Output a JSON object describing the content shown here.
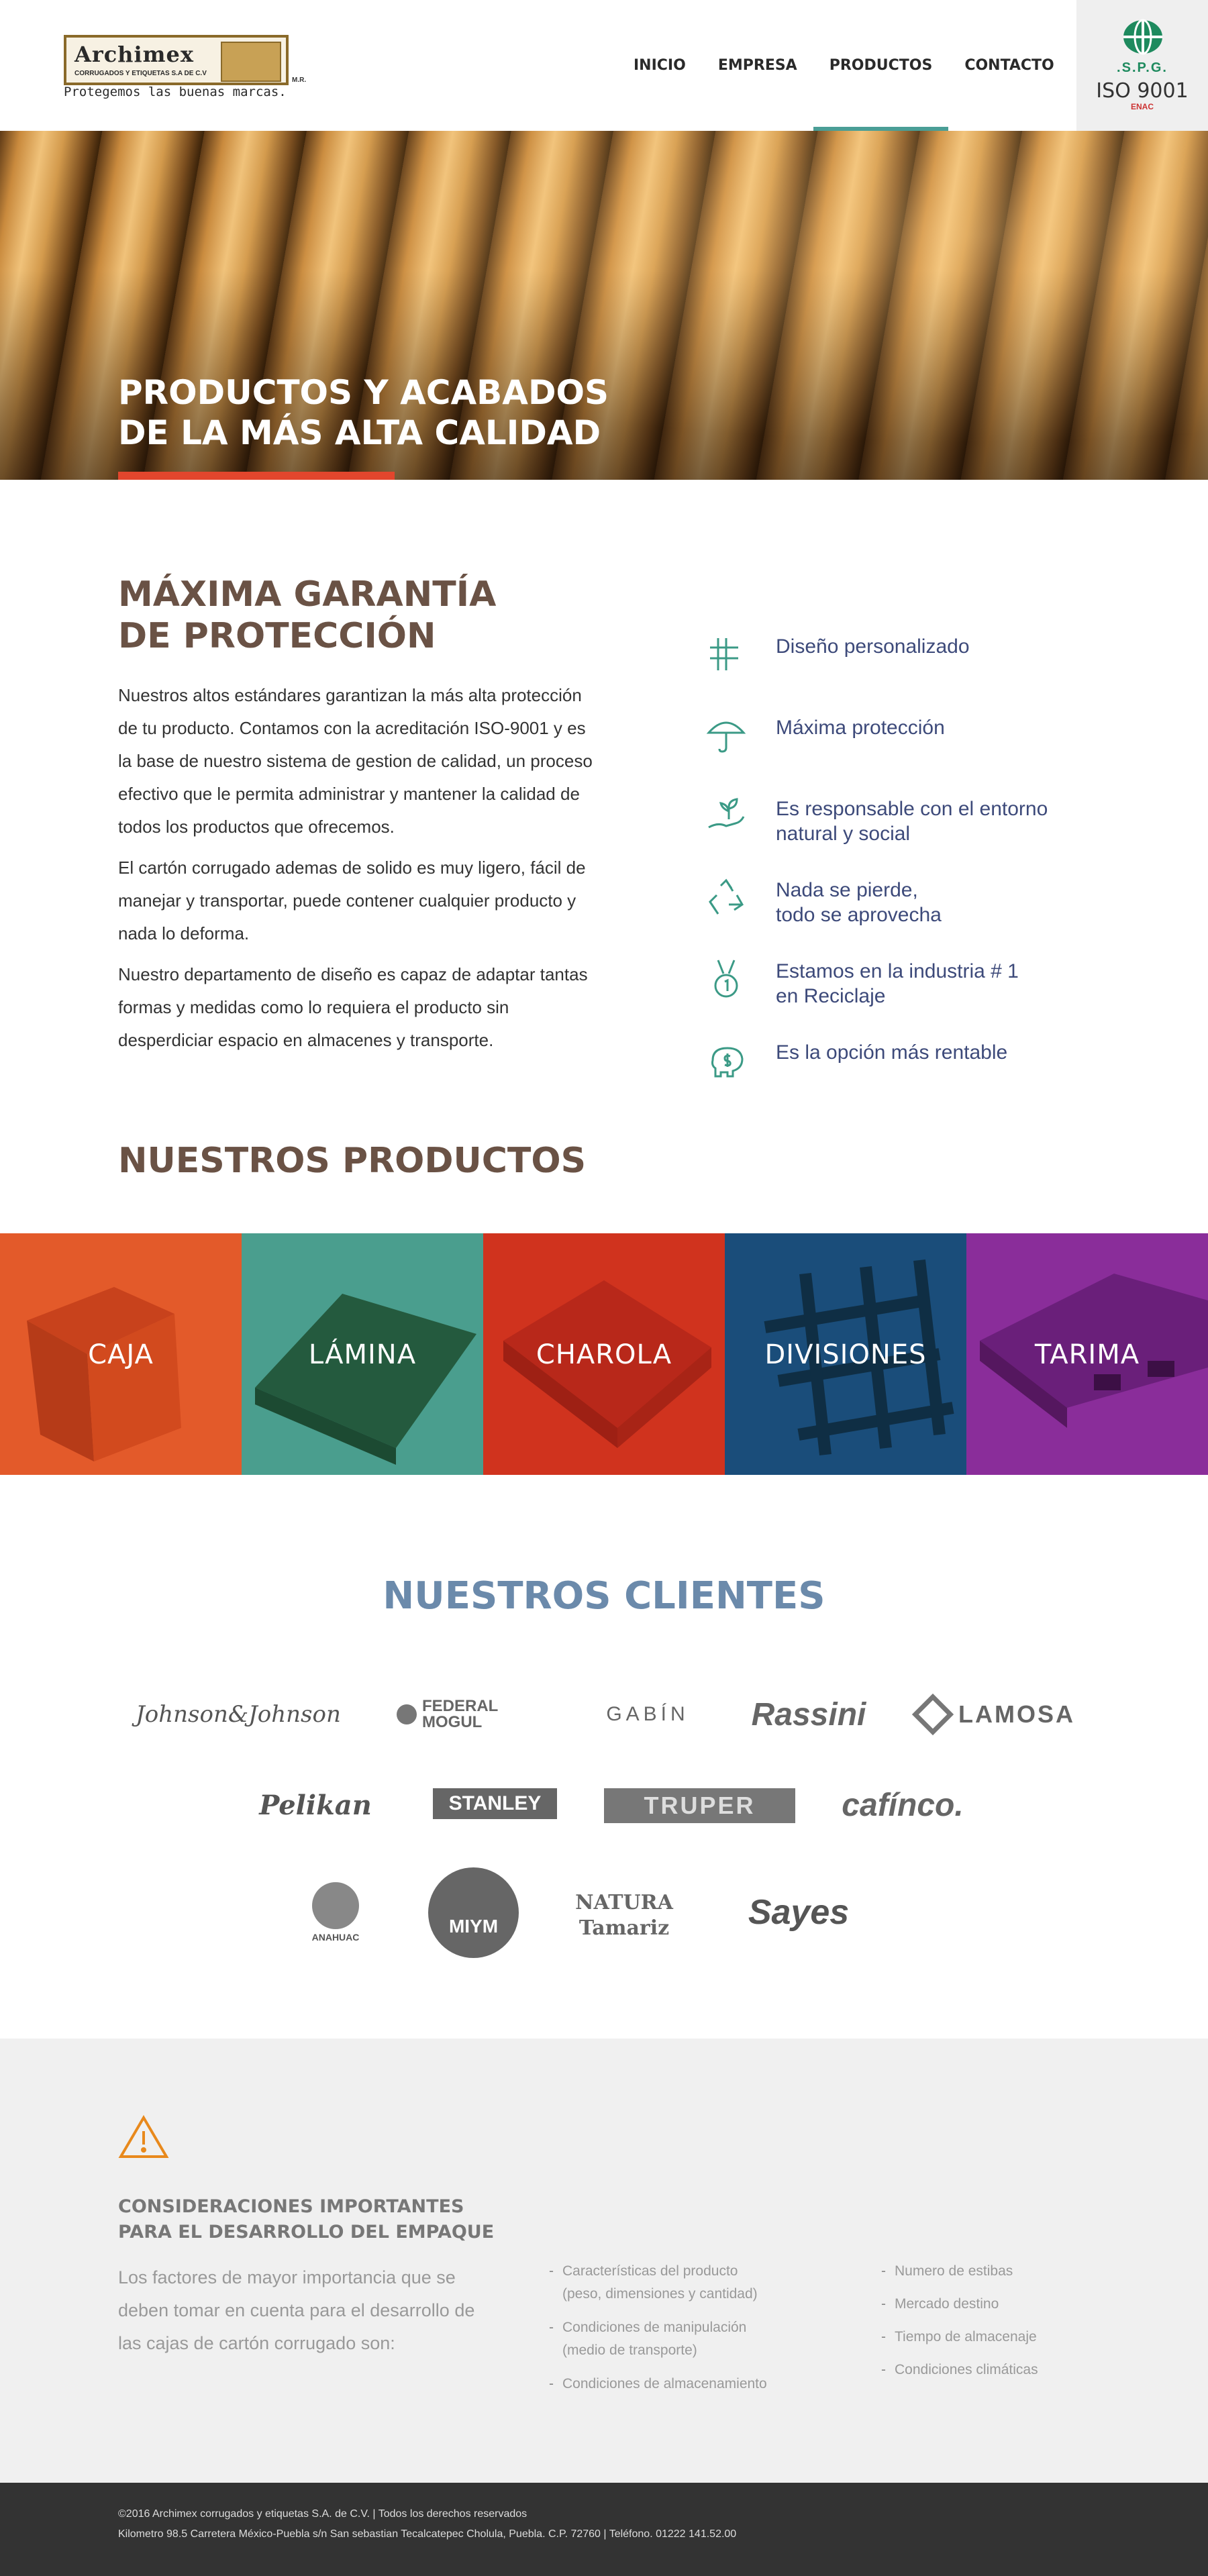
{
  "header": {
    "logo": {
      "name": "Archimex",
      "subtitle": "CORRUGADOS Y ETIQUETAS S.A DE C.V",
      "suffix": "M.R.",
      "tagline": "Protegemos las buenas marcas."
    },
    "nav": [
      {
        "label": "INICIO",
        "active": false
      },
      {
        "label": "EMPRESA",
        "active": false
      },
      {
        "label": "PRODUCTOS",
        "active": true
      },
      {
        "label": "CONTACTO",
        "active": false
      }
    ],
    "badge": {
      "spg": ".S.P.G.",
      "iso": "ISO 9001",
      "enac": "ENAC"
    }
  },
  "hero": {
    "title": "PRODUCTOS Y ACABADOS\nDE LA MÁS ALTA CALIDAD",
    "accent_color": "#e2462d"
  },
  "guarantee": {
    "title": "MÁXIMA GARANTÍA\nDE PROTECCIÓN",
    "paragraphs": [
      "Nuestros altos estándares garantizan la más alta protección de tu producto. Contamos con la acreditación ISO-9001 y es la base de nuestro sistema de gestion de calidad, un proceso efectivo que le permita administrar y mantener la calidad de todos los productos que ofrecemos.",
      "El cartón corrugado ademas de solido es muy ligero, fácil de manejar y transportar, puede contener cualquier producto y nada lo deforma.",
      "Nuestro departamento de diseño es capaz de adaptar tantas formas y medidas como lo requiera el producto sin desperdiciar espacio en almacenes y transporte."
    ],
    "features": [
      {
        "icon": "design-tools-icon",
        "label": "Diseño  personalizado"
      },
      {
        "icon": "umbrella-icon",
        "label": "Máxima protección"
      },
      {
        "icon": "plant-hand-icon",
        "label": "Es responsable con el entorno\nnatural y social"
      },
      {
        "icon": "recycle-icon",
        "label": "Nada se pierde,\ntodo se aprovecha"
      },
      {
        "icon": "medal-icon",
        "label": "Estamos en la industria # 1\nen Reciclaje"
      },
      {
        "icon": "piggy-bank-icon",
        "label": "Es la opción más rentable"
      }
    ]
  },
  "products": {
    "title": "NUESTROS PRODUCTOS",
    "items": [
      {
        "label": "CAJA",
        "color": "#e35a2a"
      },
      {
        "label": "LÁMINA",
        "color": "#4a9e8e"
      },
      {
        "label": "CHAROLA",
        "color": "#d0331e"
      },
      {
        "label": "DIVISIONES",
        "color": "#1a4d7a"
      },
      {
        "label": "TARIMA",
        "color": "#8a2d9a"
      }
    ]
  },
  "clients": {
    "title": "NUESTROS CLIENTES",
    "logos": [
      "Johnson&Johnson",
      "FEDERAL MOGUL",
      "GABÍN",
      "Rassini",
      "LAMOSA",
      "Pelikan",
      "STANLEY",
      "TRUPER",
      "cafínco.",
      "ANAHUAC",
      "MIYM",
      "NATURA Tamariz",
      "Sayes"
    ]
  },
  "considerations": {
    "title": "CONSIDERACIONES IMPORTANTES\nPARA  EL DESARROLLO DEL EMPAQUE",
    "intro": "Los factores de mayor importancia que se deben tomar en cuenta para el desarrollo de las cajas de cartón corrugado son:",
    "list_a": [
      "Características del producto\n(peso, dimensiones y cantidad)",
      "Condiciones de manipulación\n(medio de transporte)",
      "Condiciones de almacenamiento"
    ],
    "list_b": [
      "Numero de estibas",
      "Mercado destino",
      "Tiempo de almacenaje",
      "Condiciones climáticas"
    ]
  },
  "footer": {
    "line1": "©2016 Archimex corrugados y etiquetas S.A. de C.V. |  Todos los derechos reservados",
    "line2": "Kilometro 98.5 Carretera México-Puebla s/n San sebastian Tecalcatepec Cholula, Puebla. C.P. 72760   |  Teléfono. 01222 141.52.00"
  }
}
